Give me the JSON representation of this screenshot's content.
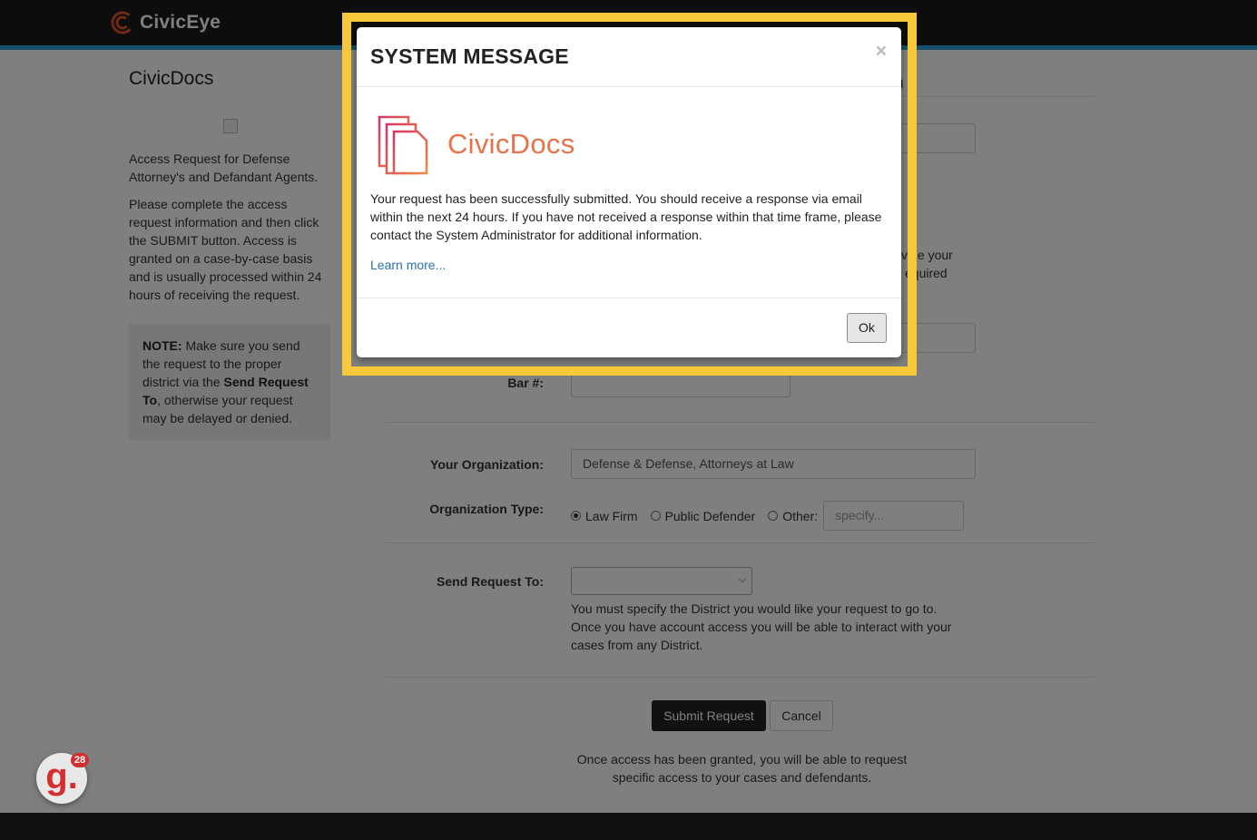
{
  "header": {
    "brand": "CivicEye"
  },
  "sidebar": {
    "title": "CivicDocs",
    "intro": "Access Request for Defense Attorney's and Defandant Agents.",
    "instructions": "Please complete the access request information and then click the SUBMIT button. Access is granted on a case-by-case basis and is usually processed within 24 hours of receiving the request.",
    "note_label": "NOTE:",
    "note_pre": " Make sure you send the request to the proper district via the ",
    "note_bold": "Send Request To",
    "note_post": ", otherwise your request may be delayed or denied."
  },
  "form": {
    "heading_fragment": "n",
    "partial_text_1": "vide your",
    "partial_text_2": "equired",
    "bar_label": "Bar #:",
    "org_label": "Your Organization:",
    "org_value": "Defense & Defense, Attorneys at Law",
    "org_type_label": "Organization Type:",
    "org_types": [
      "Law Firm",
      "Public Defender",
      "Other:"
    ],
    "org_type_selected": "Law Firm",
    "other_placeholder": "specify...",
    "send_to_label": "Send Request To:",
    "send_to_help": "You must specify the District you would like your request to go to. Once you have account access you will be able to interact with your cases from any District.",
    "submit_label": "Submit Request",
    "cancel_label": "Cancel",
    "footnote": "Once access has been granted, you will be able to request specific access to your cases and defendants."
  },
  "modal": {
    "title": "SYSTEM MESSAGE",
    "close": "×",
    "product_name": "CivicDocs",
    "message": "Your request has been successfully submitted. You should receive a response via email within the next 24 hours. If you have not received a response within that time frame, please contact the System Administrator for additional information.",
    "learn_more": "Learn more...",
    "ok_label": "Ok"
  },
  "widget": {
    "letter": "g.",
    "count": "28"
  },
  "colors": {
    "highlight": "#f7c93a",
    "accent": "#2a9fd6",
    "product": "#e8734a"
  }
}
